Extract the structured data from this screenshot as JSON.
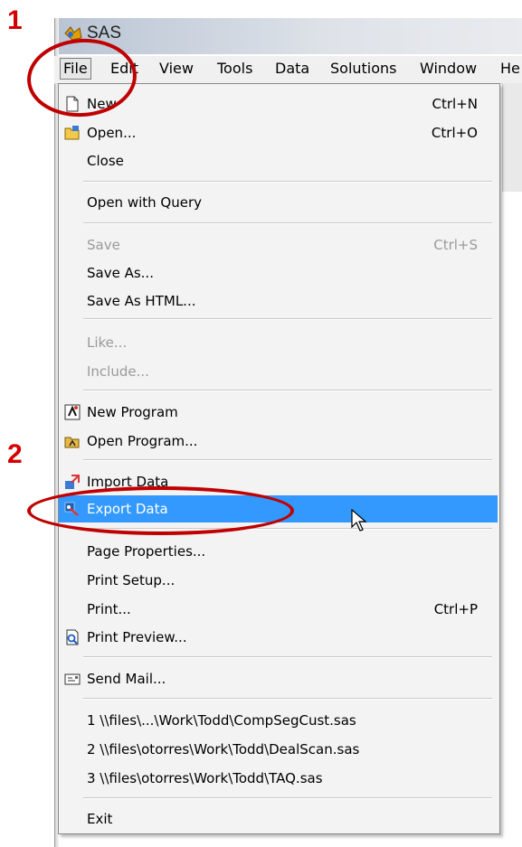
{
  "annotations": {
    "step1": "1",
    "step2": "2"
  },
  "window": {
    "title": "SAS"
  },
  "menubar": {
    "items": [
      "File",
      "Edit",
      "View",
      "Tools",
      "Data",
      "Solutions",
      "Window",
      "He"
    ]
  },
  "file_menu": {
    "items": [
      {
        "label": "New",
        "shortcut": "Ctrl+N",
        "icon": "new-document-icon"
      },
      {
        "label": "Open...",
        "shortcut": "Ctrl+O",
        "icon": "open-folder-icon"
      },
      {
        "label": "Close"
      },
      {
        "label": "Open with Query"
      },
      {
        "label": "Save",
        "shortcut": "Ctrl+S",
        "disabled": true
      },
      {
        "label": "Save As..."
      },
      {
        "label": "Save As HTML..."
      },
      {
        "label": "Like...",
        "disabled": true
      },
      {
        "label": "Include...",
        "disabled": true
      },
      {
        "label": "New Program",
        "icon": "new-program-icon"
      },
      {
        "label": "Open Program...",
        "icon": "open-program-icon"
      },
      {
        "label": "Import Data",
        "icon": "import-data-icon"
      },
      {
        "label": "Export Data",
        "icon": "export-data-icon",
        "highlighted": true
      },
      {
        "label": "Page Properties..."
      },
      {
        "label": "Print Setup..."
      },
      {
        "label": "Print...",
        "shortcut": "Ctrl+P"
      },
      {
        "label": "Print Preview...",
        "icon": "print-preview-icon"
      },
      {
        "label": "Send Mail...",
        "icon": "mail-icon"
      },
      {
        "label": "1 \\\\files\\...\\Work\\Todd\\CompSegCust.sas"
      },
      {
        "label": "2 \\\\files\\otorres\\Work\\Todd\\DealScan.sas"
      },
      {
        "label": "3 \\\\files\\otorres\\Work\\Todd\\TAQ.sas"
      },
      {
        "label": "Exit"
      }
    ]
  },
  "colors": {
    "highlight": "#3399ff",
    "annotation": "#c00000"
  }
}
